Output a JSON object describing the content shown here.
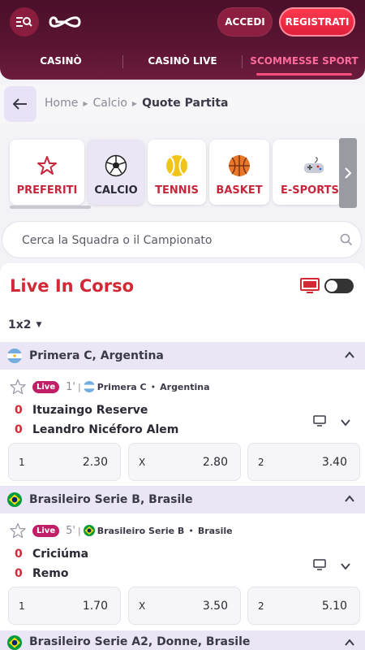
{
  "header": {
    "login_label": "ACCEDI",
    "register_label": "REGISTRATI"
  },
  "nav": {
    "tabs": [
      {
        "label": "CASINÒ",
        "active": false
      },
      {
        "label": "CASINÒ LIVE",
        "active": false
      },
      {
        "label": "SCOMMESSE SPORT",
        "active": true
      }
    ]
  },
  "breadcrumb": {
    "items": [
      "Home",
      "Calcio"
    ],
    "current": "Quote Partita"
  },
  "sports": [
    {
      "label": "PREFERITI",
      "icon": "star-icon",
      "active": false
    },
    {
      "label": "CALCIO",
      "icon": "soccer-ball-icon",
      "active": true
    },
    {
      "label": "TENNIS",
      "icon": "tennis-ball-icon",
      "active": false
    },
    {
      "label": "BASKET",
      "icon": "basketball-icon",
      "active": false
    },
    {
      "label": "E-SPORTS +",
      "icon": "gamepad-icon",
      "active": false
    }
  ],
  "search": {
    "placeholder": "Cerca la Squadra o il Campionato"
  },
  "live": {
    "title": "Live In Corso",
    "market": "1x2"
  },
  "leagues": [
    {
      "name": "Primera C, Argentina",
      "flag": "argentina",
      "match": {
        "live_label": "Live",
        "minute": "1'",
        "competition": "Primera C",
        "country": "Argentina",
        "home": {
          "score": "0",
          "team": "Ituzaingo Reserve"
        },
        "away": {
          "score": "0",
          "team": "Leandro Nicéforo Alem"
        },
        "odds": [
          {
            "label": "1",
            "value": "2.30"
          },
          {
            "label": "X",
            "value": "2.80"
          },
          {
            "label": "2",
            "value": "3.40"
          }
        ]
      }
    },
    {
      "name": "Brasileiro Serie B, Brasile",
      "flag": "brazil",
      "match": {
        "live_label": "Live",
        "minute": "5'",
        "competition": "Brasileiro Serie B",
        "country": "Brasile",
        "home": {
          "score": "0",
          "team": "Criciúma"
        },
        "away": {
          "score": "0",
          "team": "Remo"
        },
        "odds": [
          {
            "label": "1",
            "value": "1.70"
          },
          {
            "label": "X",
            "value": "3.50"
          },
          {
            "label": "2",
            "value": "5.10"
          }
        ]
      }
    },
    {
      "name": "Brasileiro Serie A2, Donne, Brasile",
      "flag": "brazil"
    }
  ],
  "colors": {
    "brand_dark": "#4a0f2a",
    "accent_red": "#d12a36",
    "live_badge": "#c01f68",
    "league_bg": "#ebe6f6"
  }
}
